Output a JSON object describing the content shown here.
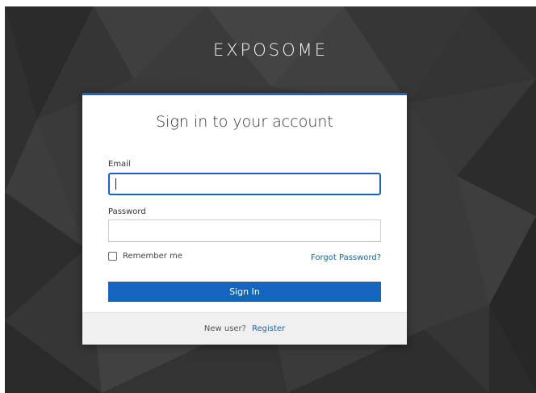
{
  "brand": {
    "name": "EXPOSOME"
  },
  "login": {
    "title": "Sign in to your account",
    "email_label": "Email",
    "email_value": "",
    "password_label": "Password",
    "password_value": "",
    "remember_label": "Remember me",
    "remember_checked": false,
    "forgot_label": "Forgot Password?",
    "signin_label": "Sign In",
    "new_user_text": "New user?",
    "register_label": "Register"
  },
  "colors": {
    "accent": "#1565c0",
    "background": "#3a3a3a",
    "footer": "#f0f0f0"
  }
}
